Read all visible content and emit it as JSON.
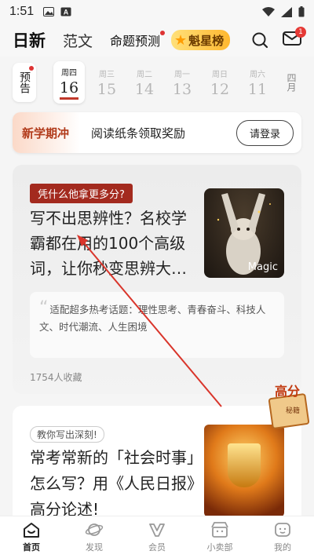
{
  "status_bar": {
    "time": "1:51"
  },
  "top_nav": {
    "tabs": [
      {
        "label": "日新",
        "active": true
      },
      {
        "label": "范文",
        "active": false
      },
      {
        "label": "命题预测",
        "active": false,
        "dot": true
      }
    ],
    "star_board_label": "魁星榜",
    "mail_badge": "1"
  },
  "date_strip": {
    "forecast_label": "预告",
    "days": [
      {
        "weekday": "周四",
        "date": "16",
        "active": true
      },
      {
        "weekday": "周三",
        "date": "15"
      },
      {
        "weekday": "周二",
        "date": "14"
      },
      {
        "weekday": "周一",
        "date": "13"
      },
      {
        "weekday": "周日",
        "date": "12"
      },
      {
        "weekday": "周六",
        "date": "11"
      }
    ],
    "month_label": "四月"
  },
  "banner": {
    "tag": "新学期冲",
    "text": "阅读纸条领取奖励",
    "button": "请登录"
  },
  "card1": {
    "tag": "凭什么他拿更多分?",
    "title": "写不出思辨性？名校学霸都在用的100个高级词，让你秒变思辨大…",
    "thumb_caption": "Magic",
    "quote": "适配超多热考话题：理性思考、青春奋斗、科技人文、时代潮流、人生困境",
    "favorites": "1754人收藏"
  },
  "card2": {
    "tag": "教你写出深刻!",
    "title": "常考常新的「社会时事」怎么写？用《人民日报》高分论述!"
  },
  "float_badge": {
    "word": "高分",
    "sub": "秘籍"
  },
  "tab_bar": [
    {
      "label": "首页",
      "icon": "home-icon",
      "active": true
    },
    {
      "label": "发现",
      "icon": "planet-icon"
    },
    {
      "label": "会员",
      "icon": "vip-icon"
    },
    {
      "label": "小卖部",
      "icon": "shop-icon"
    },
    {
      "label": "我的",
      "icon": "profile-icon"
    }
  ],
  "colors": {
    "accent": "#a32a1e",
    "badge_red": "#e53935",
    "annotation_arrow": "#d9352b"
  }
}
